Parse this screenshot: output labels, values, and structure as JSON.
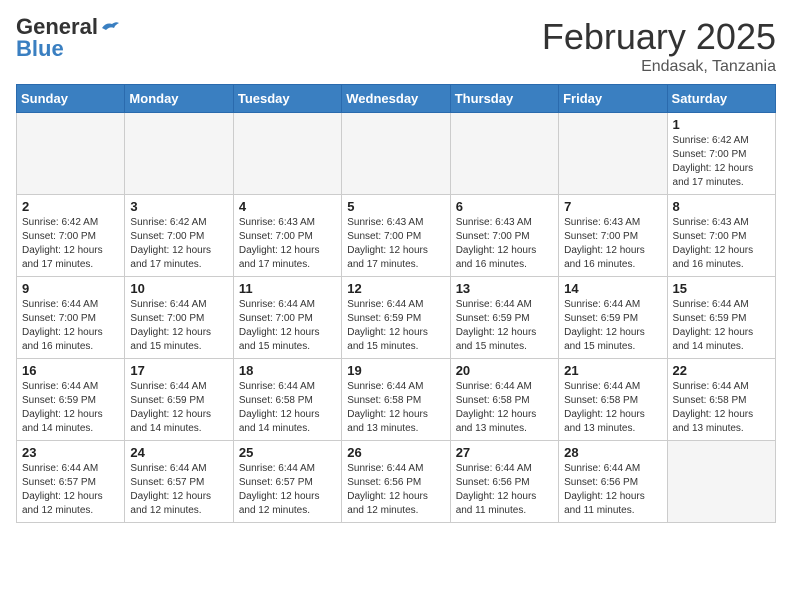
{
  "header": {
    "logo_general": "General",
    "logo_blue": "Blue",
    "month_title": "February 2025",
    "location": "Endasak, Tanzania"
  },
  "weekdays": [
    "Sunday",
    "Monday",
    "Tuesday",
    "Wednesday",
    "Thursday",
    "Friday",
    "Saturday"
  ],
  "weeks": [
    [
      {
        "day": "",
        "info": ""
      },
      {
        "day": "",
        "info": ""
      },
      {
        "day": "",
        "info": ""
      },
      {
        "day": "",
        "info": ""
      },
      {
        "day": "",
        "info": ""
      },
      {
        "day": "",
        "info": ""
      },
      {
        "day": "1",
        "info": "Sunrise: 6:42 AM\nSunset: 7:00 PM\nDaylight: 12 hours\nand 17 minutes."
      }
    ],
    [
      {
        "day": "2",
        "info": "Sunrise: 6:42 AM\nSunset: 7:00 PM\nDaylight: 12 hours\nand 17 minutes."
      },
      {
        "day": "3",
        "info": "Sunrise: 6:42 AM\nSunset: 7:00 PM\nDaylight: 12 hours\nand 17 minutes."
      },
      {
        "day": "4",
        "info": "Sunrise: 6:43 AM\nSunset: 7:00 PM\nDaylight: 12 hours\nand 17 minutes."
      },
      {
        "day": "5",
        "info": "Sunrise: 6:43 AM\nSunset: 7:00 PM\nDaylight: 12 hours\nand 17 minutes."
      },
      {
        "day": "6",
        "info": "Sunrise: 6:43 AM\nSunset: 7:00 PM\nDaylight: 12 hours\nand 16 minutes."
      },
      {
        "day": "7",
        "info": "Sunrise: 6:43 AM\nSunset: 7:00 PM\nDaylight: 12 hours\nand 16 minutes."
      },
      {
        "day": "8",
        "info": "Sunrise: 6:43 AM\nSunset: 7:00 PM\nDaylight: 12 hours\nand 16 minutes."
      }
    ],
    [
      {
        "day": "9",
        "info": "Sunrise: 6:44 AM\nSunset: 7:00 PM\nDaylight: 12 hours\nand 16 minutes."
      },
      {
        "day": "10",
        "info": "Sunrise: 6:44 AM\nSunset: 7:00 PM\nDaylight: 12 hours\nand 15 minutes."
      },
      {
        "day": "11",
        "info": "Sunrise: 6:44 AM\nSunset: 7:00 PM\nDaylight: 12 hours\nand 15 minutes."
      },
      {
        "day": "12",
        "info": "Sunrise: 6:44 AM\nSunset: 6:59 PM\nDaylight: 12 hours\nand 15 minutes."
      },
      {
        "day": "13",
        "info": "Sunrise: 6:44 AM\nSunset: 6:59 PM\nDaylight: 12 hours\nand 15 minutes."
      },
      {
        "day": "14",
        "info": "Sunrise: 6:44 AM\nSunset: 6:59 PM\nDaylight: 12 hours\nand 15 minutes."
      },
      {
        "day": "15",
        "info": "Sunrise: 6:44 AM\nSunset: 6:59 PM\nDaylight: 12 hours\nand 14 minutes."
      }
    ],
    [
      {
        "day": "16",
        "info": "Sunrise: 6:44 AM\nSunset: 6:59 PM\nDaylight: 12 hours\nand 14 minutes."
      },
      {
        "day": "17",
        "info": "Sunrise: 6:44 AM\nSunset: 6:59 PM\nDaylight: 12 hours\nand 14 minutes."
      },
      {
        "day": "18",
        "info": "Sunrise: 6:44 AM\nSunset: 6:58 PM\nDaylight: 12 hours\nand 14 minutes."
      },
      {
        "day": "19",
        "info": "Sunrise: 6:44 AM\nSunset: 6:58 PM\nDaylight: 12 hours\nand 13 minutes."
      },
      {
        "day": "20",
        "info": "Sunrise: 6:44 AM\nSunset: 6:58 PM\nDaylight: 12 hours\nand 13 minutes."
      },
      {
        "day": "21",
        "info": "Sunrise: 6:44 AM\nSunset: 6:58 PM\nDaylight: 12 hours\nand 13 minutes."
      },
      {
        "day": "22",
        "info": "Sunrise: 6:44 AM\nSunset: 6:58 PM\nDaylight: 12 hours\nand 13 minutes."
      }
    ],
    [
      {
        "day": "23",
        "info": "Sunrise: 6:44 AM\nSunset: 6:57 PM\nDaylight: 12 hours\nand 12 minutes."
      },
      {
        "day": "24",
        "info": "Sunrise: 6:44 AM\nSunset: 6:57 PM\nDaylight: 12 hours\nand 12 minutes."
      },
      {
        "day": "25",
        "info": "Sunrise: 6:44 AM\nSunset: 6:57 PM\nDaylight: 12 hours\nand 12 minutes."
      },
      {
        "day": "26",
        "info": "Sunrise: 6:44 AM\nSunset: 6:56 PM\nDaylight: 12 hours\nand 12 minutes."
      },
      {
        "day": "27",
        "info": "Sunrise: 6:44 AM\nSunset: 6:56 PM\nDaylight: 12 hours\nand 11 minutes."
      },
      {
        "day": "28",
        "info": "Sunrise: 6:44 AM\nSunset: 6:56 PM\nDaylight: 12 hours\nand 11 minutes."
      },
      {
        "day": "",
        "info": ""
      }
    ]
  ]
}
